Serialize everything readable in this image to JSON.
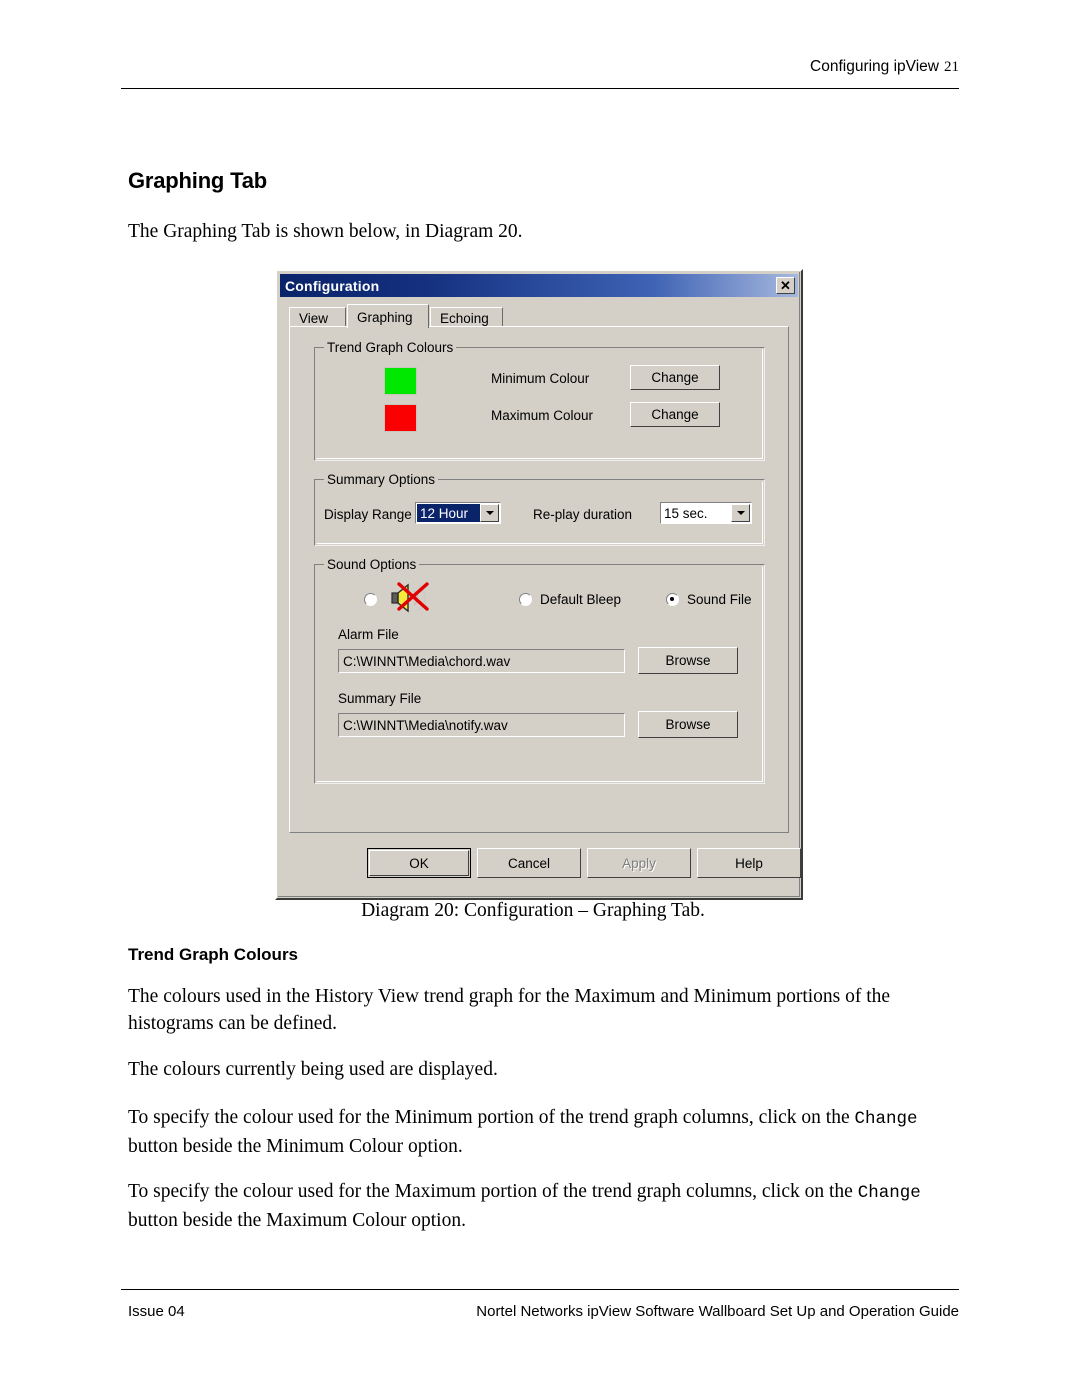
{
  "page": {
    "header_title": "Configuring ipView",
    "page_number": "21",
    "footer_issue": "Issue 04",
    "footer_guide": "Nortel Networks ipView Software Wallboard Set Up and Operation Guide"
  },
  "content": {
    "section_title": "Graphing Tab",
    "intro": "The Graphing Tab is shown below, in Diagram 20.",
    "figure_caption": "Diagram 20: Configuration – Graphing Tab.",
    "subsection_title": "Trend Graph Colours",
    "para1": "The colours used in the History View trend graph for the Maximum and Minimum portions of the histograms can be defined.",
    "para2": "The colours currently being used are displayed.",
    "para3_a": "To specify the colour used for the Minimum portion of the trend graph columns, click on the ",
    "para3_mono": "Change",
    "para3_b": "  button beside the Minimum Colour option.",
    "para4_a": "To specify the colour used for the Maximum portion of the trend graph columns, click on the ",
    "para4_mono": "Change",
    "para4_b": " button beside the Maximum Colour option."
  },
  "dialog": {
    "title": "Configuration",
    "close_label": "✕",
    "tabs": [
      {
        "label": "View",
        "active": false
      },
      {
        "label": "Graphing",
        "active": true
      },
      {
        "label": "Echoing",
        "active": false
      }
    ],
    "trend_group": {
      "legend": "Trend Graph Colours",
      "minimum_label": "Minimum Colour",
      "minimum_colour": "#00e800",
      "minimum_button": "Change",
      "maximum_label": "Maximum Colour",
      "maximum_colour": "#fa0000",
      "maximum_button": "Change"
    },
    "summary_group": {
      "legend": "Summary Options",
      "display_range_label": "Display Range",
      "display_range_value": "12 Hour",
      "replay_label": "Re-play duration",
      "replay_value": "15 sec."
    },
    "sound_group": {
      "legend": "Sound Options",
      "mute_option_selected": false,
      "default_bleep_label": "Default Bleep",
      "default_bleep_selected": false,
      "sound_file_label": "Sound File",
      "sound_file_selected": true,
      "alarm_file_label": "Alarm File",
      "alarm_file_value": "C:\\WINNT\\Media\\chord.wav",
      "alarm_browse": "Browse",
      "summary_file_label": "Summary File",
      "summary_file_value": "C:\\WINNT\\Media\\notify.wav",
      "summary_browse": "Browse"
    },
    "buttons": {
      "ok": "OK",
      "cancel": "Cancel",
      "apply": "Apply",
      "help": "Help"
    }
  }
}
